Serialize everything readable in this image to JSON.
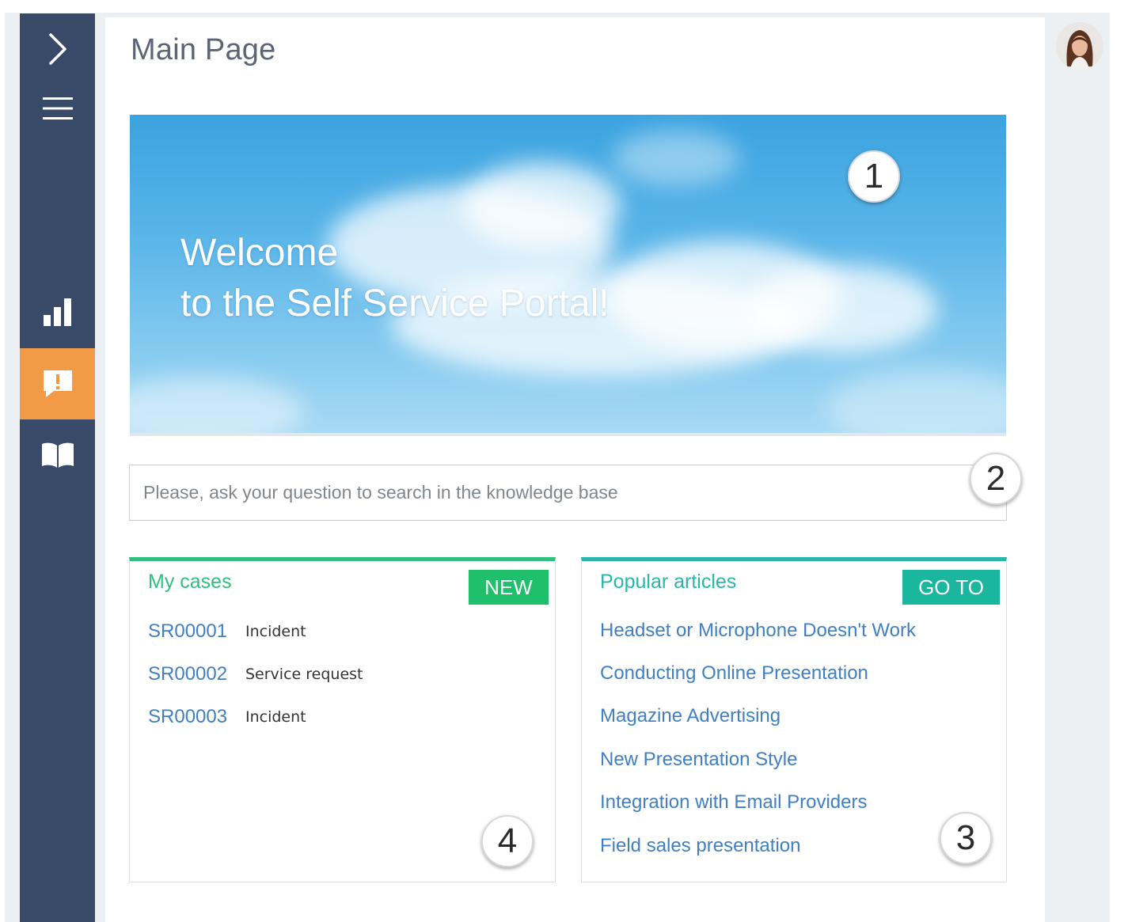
{
  "page": {
    "title": "Main Page"
  },
  "colors": {
    "sidebar": "#384a68",
    "active": "#f29a46",
    "cases_accent": "#30c07d",
    "articles_accent": "#27b6a9",
    "link": "#3f7fc2"
  },
  "sidebar": {
    "items": [
      {
        "icon": "chevron-right-icon"
      },
      {
        "icon": "hamburger-menu-icon"
      },
      {
        "icon": "bar-chart-icon"
      },
      {
        "icon": "alert-message-icon",
        "active": true
      },
      {
        "icon": "book-icon"
      }
    ]
  },
  "banner": {
    "line1": "Welcome",
    "line2": "to the Self Service Portal!"
  },
  "search": {
    "placeholder": "Please, ask your question to search in the knowledge base"
  },
  "markers": [
    "1",
    "2",
    "3",
    "4"
  ],
  "cases": {
    "title": "My cases",
    "button": "NEW",
    "items": [
      {
        "id": "SR00001",
        "type": "Incident"
      },
      {
        "id": "SR00002",
        "type": "Service request"
      },
      {
        "id": "SR00003",
        "type": "Incident"
      }
    ]
  },
  "articles": {
    "title": "Popular articles",
    "button": "GO TO",
    "items": [
      "Headset or Microphone Doesn't Work",
      "Conducting Online Presentation",
      "Magazine Advertising",
      "New Presentation Style",
      "Integration with Email Providers",
      "Field sales presentation"
    ]
  }
}
